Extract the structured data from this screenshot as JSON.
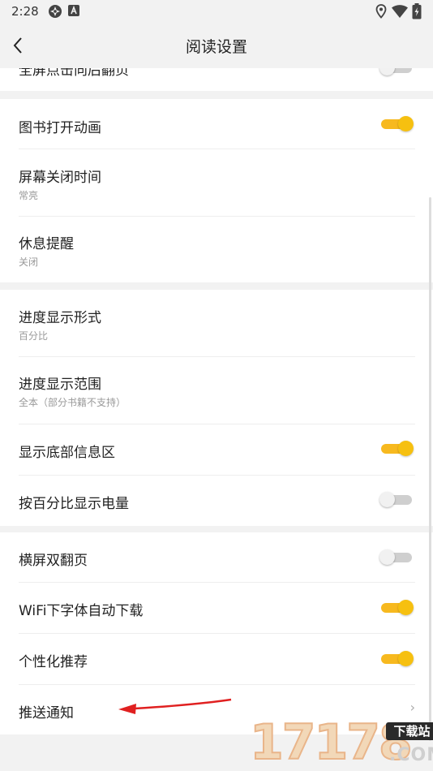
{
  "status_bar": {
    "time": "2:28",
    "icons": [
      "app-icon",
      "a-badge-icon",
      "location-icon",
      "wifi-icon",
      "battery-icon"
    ]
  },
  "header": {
    "title": "阅读设置",
    "back_icon": "back-arrow-icon"
  },
  "partial_row": {
    "label": "全屏点击向后翻页",
    "toggle_on": false
  },
  "group1": [
    {
      "label": "图书打开动画",
      "toggle_on": true
    },
    {
      "label": "屏幕关闭时间",
      "value": "常亮"
    },
    {
      "label": "休息提醒",
      "value": "关闭"
    }
  ],
  "group2": [
    {
      "label": "进度显示形式",
      "value": "百分比"
    },
    {
      "label": "进度显示范围",
      "value": "全本（部分书籍不支持）"
    },
    {
      "label": "显示底部信息区",
      "toggle_on": true
    },
    {
      "label": "按百分比显示电量",
      "toggle_on": false
    }
  ],
  "group3": [
    {
      "label": "横屏双翻页",
      "toggle_on": false
    },
    {
      "label": "WiFi下字体自动下载",
      "toggle_on": true
    },
    {
      "label": "个性化推荐",
      "toggle_on": true
    },
    {
      "label": "推送通知",
      "chevron": "›"
    }
  ],
  "colors": {
    "accent": "#f6c010",
    "toggle_off": "#cfcfcf",
    "annotation_arrow": "#e02020"
  },
  "watermark": {
    "digits": "17178",
    "tag": "下载站",
    "domain": ".COM"
  }
}
